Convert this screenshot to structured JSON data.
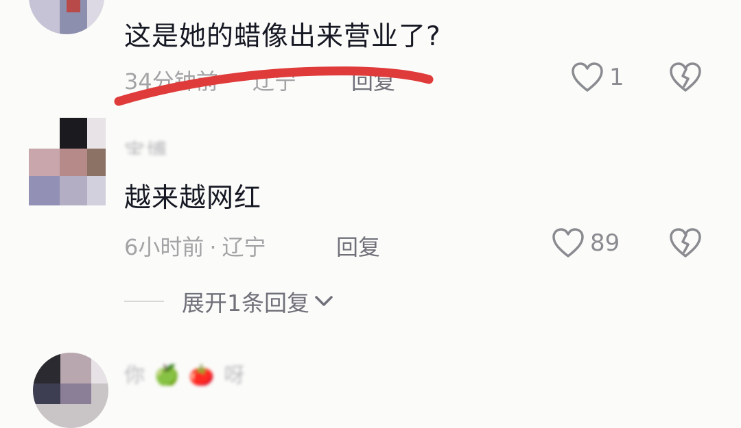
{
  "comments": [
    {
      "text": "这是她的蜡像出来营业了?",
      "time": "34分钟前",
      "location": "辽宁",
      "reply_label": "回复",
      "like_count": "1"
    },
    {
      "username": "宝博",
      "text": "越来越网红",
      "time": "6小时前",
      "separator": "·",
      "location": "辽宁",
      "reply_label": "回复",
      "like_count": "89",
      "expand_label": "展开1条回复"
    },
    {
      "username": "你 🍏 🍅 呀"
    }
  ],
  "icons": {
    "like": "heart-outline-icon",
    "dislike": "broken-heart-icon",
    "expand": "chevron-down-icon"
  },
  "colors": {
    "background": "#fbfbf9",
    "text": "#161823",
    "meta": "#a3a3a6",
    "strike_mark": "#e03b3b"
  }
}
